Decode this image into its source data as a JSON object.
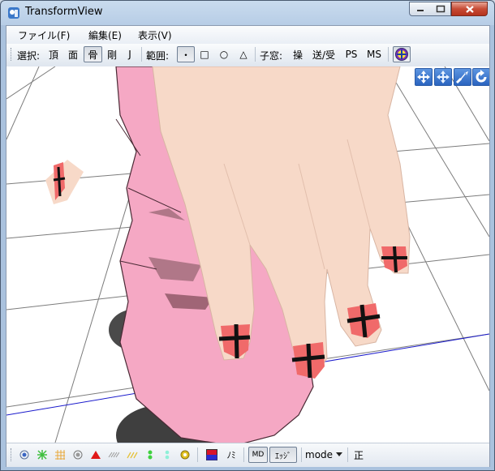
{
  "window": {
    "title": "TransformView"
  },
  "menu": {
    "file": "ファイル(F)",
    "edit": "編集(E)",
    "view": "表示(V)"
  },
  "toolbar": {
    "select_label": "選択:",
    "vertex": "頂",
    "face": "面",
    "bone": "骨",
    "rigid": "剛",
    "joint": "J",
    "range_label": "範囲:",
    "range_point": "・",
    "range_rect": "□",
    "range_circle": "○",
    "range_triangle": "△",
    "child_window_label": "子窓:",
    "operate": "操",
    "send_receive": "送/受",
    "ps": "PS",
    "ms": "MS",
    "selected_mode": "骨",
    "selected_range": "・"
  },
  "bottombar": {
    "nomi": "ﾉﾐ",
    "md_button": "MD",
    "edge_button": "ｴｯｼﾞ",
    "mode_select": "mode",
    "correct": "正"
  },
  "icons": {
    "app": "pmx-app-icon",
    "target": "target-icon",
    "nav_move_xy": "move-arrows-icon",
    "nav_move_xz": "move-cross-icon",
    "nav_zoom": "zoom-arrow-icon",
    "nav_rotate": "rotate-icon"
  },
  "colors": {
    "viewport_bg": "#ffffff",
    "skin": "#f7d9c8",
    "dress": "#f5a8c4",
    "nail": "#f06a6a",
    "accent_blue": "#2a64c0"
  }
}
